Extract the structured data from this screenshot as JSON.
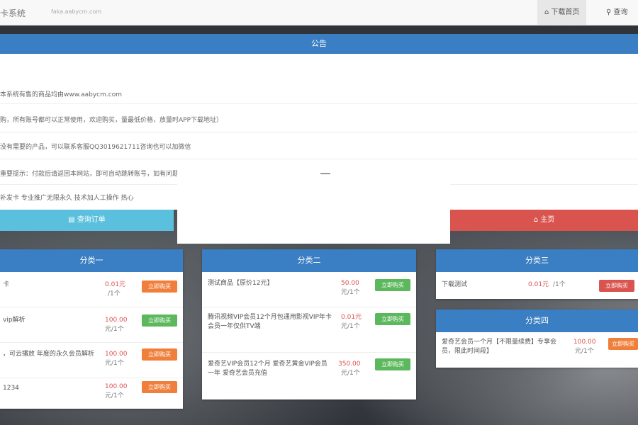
{
  "nav": {
    "brand": "卡系统",
    "url": "faka.aabycm.com",
    "home_label": "下载首页",
    "search_label": "查询"
  },
  "notice": {
    "title": "公告",
    "lines": [
      "本系统有售的商品均由www.aabycm.com",
      "购，所有账号都可以正常使用，欢迎购买，量最低价格，放量时APP下载地址）",
      "没有需要的产品，可以联系客服QQ3019621711咨询也可以加微信",
      "重要提示：付款后请返回本网站，即可自动跳转账号，如有问题联系客服。",
      "补发卡 专业推广无限永久 技术加人工操作 热心"
    ],
    "btn_query": "查询订单",
    "btn_home": "主页"
  },
  "cards": [
    {
      "title": "分类一",
      "items": [
        {
          "name": "卡",
          "price": "0.01元",
          "unit": "/1个",
          "buy": "立即购买",
          "color": "orange"
        },
        {
          "name": "vip解析",
          "price": "100.00",
          "unit": "元/1个",
          "buy": "立即购买",
          "color": "green"
        },
        {
          "name": "，可云播放 年度的永久会员解析",
          "price": "100.00",
          "unit": "元/1个",
          "buy": "立即购买",
          "color": "orange"
        },
        {
          "name": "1234",
          "price": "100.00",
          "unit": "元/1个",
          "buy": "立即购买",
          "color": "orange"
        }
      ]
    },
    {
      "title": "分类二",
      "items": [
        {
          "name": "测试商品【原价12元】",
          "price": "50.00",
          "unit": "元/1个",
          "buy": "立即购买",
          "color": "green"
        },
        {
          "name": "腾讯视频VIP会员12个月包通用影视VIP年卡会员一年仅供TV端",
          "price": "0.01元",
          "unit": "元/1个",
          "buy": "立即购买",
          "color": "green"
        },
        {
          "name": "爱奇艺VIP会员12个月 爱奇艺黄金VIP会员一年 爱奇艺会员充值",
          "price": "350.00",
          "unit": "元/1个",
          "buy": "立即购买",
          "color": "green"
        }
      ]
    },
    {
      "title": "分类三",
      "items": [
        {
          "name": "下载测试",
          "price": "0.01元",
          "unit": "/1个",
          "buy": "立即购买",
          "color": "red"
        }
      ]
    },
    {
      "title": "分类四",
      "items": [
        {
          "name": "爱奇艺会员一个月【不限量续费】专享会员，限此时间段】",
          "price": "100.00",
          "unit": "元/1个",
          "buy": "立即购买",
          "color": "orange"
        }
      ]
    }
  ]
}
